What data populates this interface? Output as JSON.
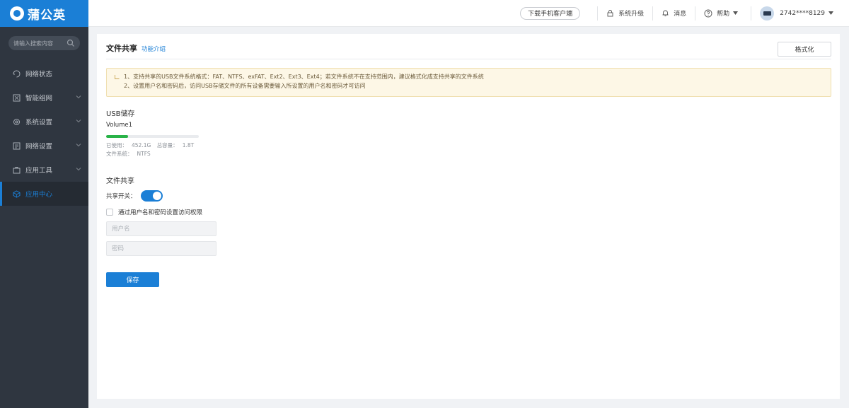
{
  "app": {
    "brand": "蒲公英",
    "brand_color": "#1b7fd6"
  },
  "sidebar": {
    "search_placeholder": "请输入搜索内容",
    "items": [
      {
        "label": "网络状态",
        "icon": "network-status-icon",
        "has_submenu": false
      },
      {
        "label": "智能组网",
        "icon": "smart-network-icon",
        "has_submenu": true
      },
      {
        "label": "系统设置",
        "icon": "gear-icon",
        "has_submenu": true
      },
      {
        "label": "网络设置",
        "icon": "network-settings-icon",
        "has_submenu": true
      },
      {
        "label": "应用工具",
        "icon": "toolbox-icon",
        "has_submenu": true
      },
      {
        "label": "应用中心",
        "icon": "app-center-icon",
        "has_submenu": false,
        "active": true
      }
    ]
  },
  "topbar": {
    "download_label": "下载手机客户端",
    "upgrade_label": "系统升级",
    "messages_label": "消息",
    "help_label": "帮助",
    "user_label": "2742****8129"
  },
  "page": {
    "title": "文件共享",
    "intro_link": "功能介绍",
    "format_button": "格式化",
    "notice": {
      "line1": "1、支持共享的USB文件系统格式：FAT、NTFS、exFAT、Ext2、Ext3、Ext4；若文件系统不在支持范围内，建议格式化成支持共享的文件系统",
      "line2": "2、设置用户名和密码后，访问USB存储文件的所有设备需要输入所设置的用户名和密码才可访问"
    },
    "usb": {
      "section_title": "USB储存",
      "volume_name": "Volume1",
      "usage_fraction": 0.24,
      "used_label": "已使用：",
      "used_value": "452.1G",
      "total_label": "总容量：",
      "total_value": "1.8T",
      "fs_label": "文件系统：",
      "fs_value": "NTFS"
    },
    "share": {
      "section_title": "文件共享",
      "switch_label": "共享开关：",
      "switch_on": true,
      "auth_checkbox_label": "通过用户名和密码设置访问权限",
      "auth_checked": false,
      "username_placeholder": "用户名",
      "password_placeholder": "密码",
      "save_button": "保存"
    }
  }
}
